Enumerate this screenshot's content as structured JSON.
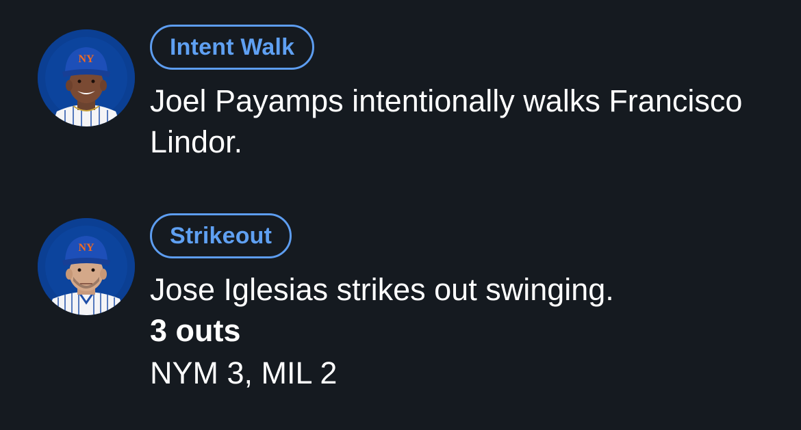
{
  "plays": [
    {
      "player": "Francisco Lindor",
      "avatar_icon": "player-headshot-icon",
      "event": "Intent Walk",
      "description": "Joel Payamps intentionally walks Francisco Lindor."
    },
    {
      "player": "Jose Iglesias",
      "avatar_icon": "player-headshot-icon",
      "event": "Strikeout",
      "description": "Jose Iglesias strikes out swinging.",
      "outs": "3 outs",
      "score": "NYM 3, MIL 2"
    }
  ],
  "colors": {
    "background": "#151a20",
    "badge_accent": "#5fa0f2",
    "text": "#ffffff",
    "cap_blue": "#1d4fb8",
    "logo_orange": "#f26a21"
  }
}
